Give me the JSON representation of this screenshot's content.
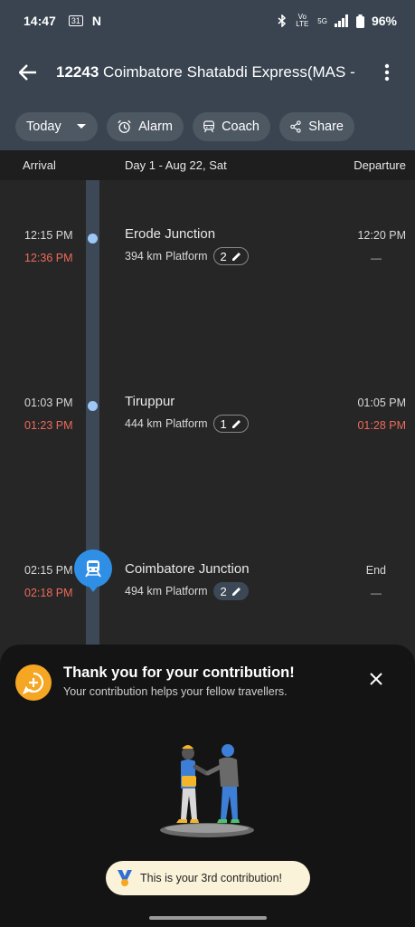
{
  "status_bar": {
    "time": "14:47",
    "calendar_badge": "31",
    "notif_letter": "N",
    "network_vo": "Vo LTE",
    "network_5g": "5G",
    "battery": "96%"
  },
  "header": {
    "train_number": "12243",
    "train_name": "Coimbatore Shatabdi Express(MAS - C..."
  },
  "chips": [
    {
      "label": "Today",
      "icon": "chevron-down-icon"
    },
    {
      "label": "Alarm",
      "icon": "alarm-clock-icon"
    },
    {
      "label": "Coach",
      "icon": "train-icon"
    },
    {
      "label": "Share",
      "icon": "share-icon"
    }
  ],
  "columns": {
    "arrival": "Arrival",
    "day": "Day 1 - Aug 22, Sat",
    "departure": "Departure"
  },
  "stations": [
    {
      "name": "Erode Junction",
      "km": "394 km",
      "platform_label": "Platform",
      "platform": "2",
      "arr_sched": "12:15 PM",
      "arr_actual": "12:36 PM",
      "dep_sched": "12:20 PM",
      "dep_actual": "—"
    },
    {
      "name": "Tiruppur",
      "km": "444 km",
      "platform_label": "Platform",
      "platform": "1",
      "arr_sched": "01:03 PM",
      "arr_actual": "01:23 PM",
      "dep_sched": "01:05 PM",
      "dep_actual": "01:28 PM"
    },
    {
      "name": "Coimbatore Junction",
      "km": "494 km",
      "platform_label": "Platform",
      "platform": "2",
      "arr_sched": "02:15 PM",
      "arr_actual": "02:18 PM",
      "dep_sched": "End",
      "dep_actual": "—"
    }
  ],
  "sheet": {
    "title": "Thank you for your contribution!",
    "subtitle": "Your contribution helps your fellow travellers.",
    "toast": "This is your 3rd contribution!"
  },
  "colors": {
    "app_bar": "#394450",
    "accent_blue": "#2f8fe6",
    "late_red": "#ef6a5a",
    "contrib_orange": "#f5a623"
  }
}
